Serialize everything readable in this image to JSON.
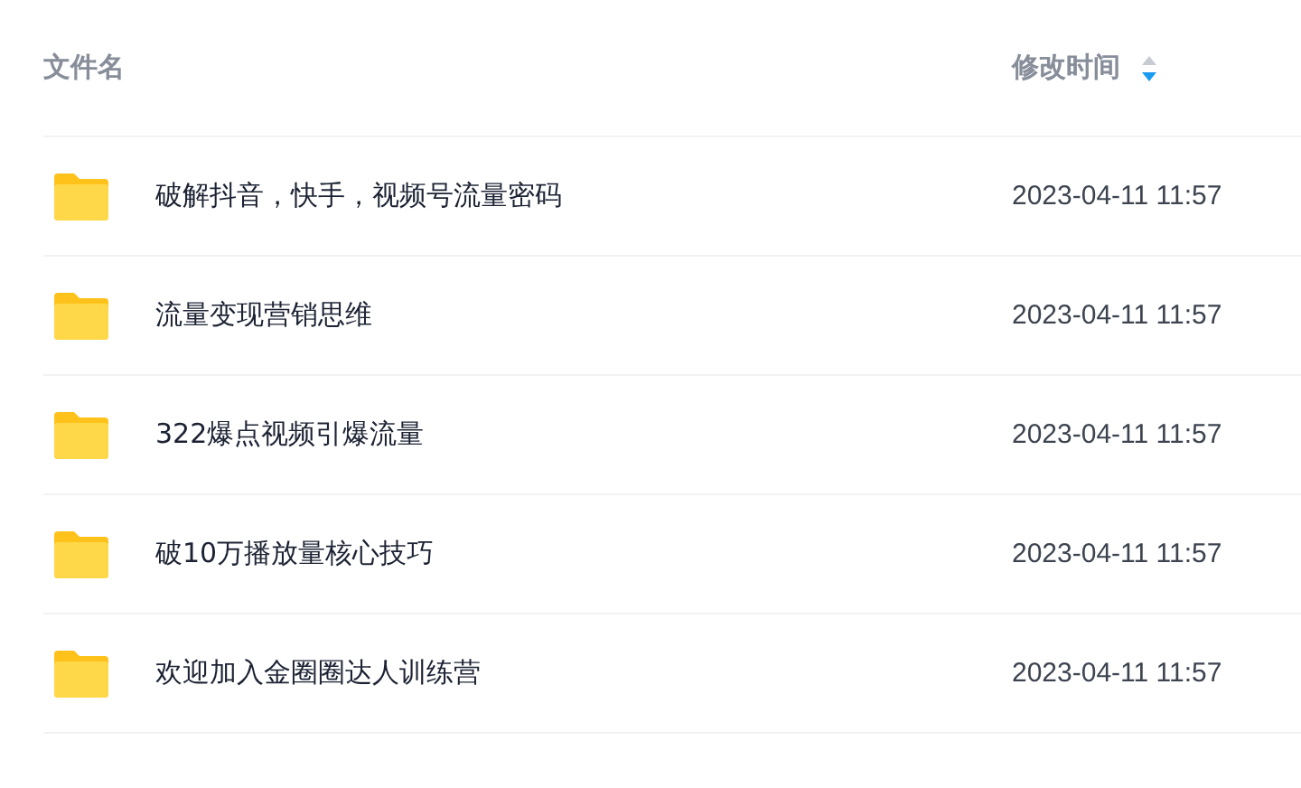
{
  "table": {
    "columns": [
      {
        "label": "文件名"
      },
      {
        "label": "修改时间",
        "sort_descending": true
      }
    ],
    "rows": [
      {
        "kind": "folder",
        "name": "破解抖音，快手，视频号流量密码",
        "modified": "2023-04-11 11:57"
      },
      {
        "kind": "folder",
        "name": "流量变现营销思维",
        "modified": "2023-04-11 11:57"
      },
      {
        "kind": "folder",
        "name": "322爆点视频引爆流量",
        "modified": "2023-04-11 11:57"
      },
      {
        "kind": "folder",
        "name": "破10万播放量核心技巧",
        "modified": "2023-04-11 11:57"
      },
      {
        "kind": "folder",
        "name": "欢迎加入金圈圈达人训练营",
        "modified": "2023-04-11 11:57"
      }
    ]
  }
}
